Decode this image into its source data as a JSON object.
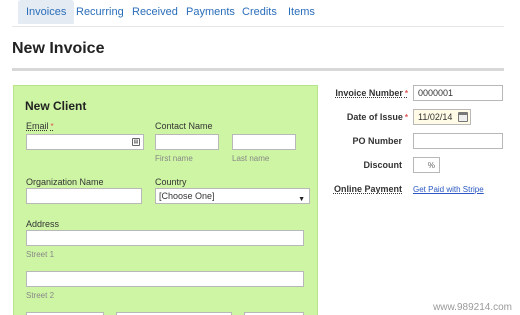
{
  "tabs": [
    {
      "label": "Invoices",
      "active": true
    },
    {
      "label": "Recurring",
      "active": false
    },
    {
      "label": "Received",
      "active": false
    },
    {
      "label": "Payments",
      "active": false
    },
    {
      "label": "Credits",
      "active": false
    },
    {
      "label": "Items",
      "active": false
    }
  ],
  "page_title": "New Invoice",
  "client": {
    "title": "New Client",
    "email_label": "Email",
    "email_value": "",
    "contact_label": "Contact Name",
    "first_name_hint": "First name",
    "last_name_hint": "Last name",
    "org_label": "Organization Name",
    "country_label": "Country",
    "country_selected": "[Choose One]",
    "address_label": "Address",
    "street1_hint": "Street 1",
    "street2_hint": "Street 2",
    "required_mark": "*"
  },
  "invoice": {
    "number_label": "Invoice Number",
    "number_value": "0000001",
    "date_label": "Date of Issue",
    "date_value": "11/02/14",
    "po_label": "PO Number",
    "po_value": "",
    "discount_label": "Discount",
    "discount_value": "",
    "discount_unit": "%",
    "online_payment_label": "Online Payment",
    "stripe_link": "Get Paid with Stripe",
    "required_mark": "*"
  },
  "watermark": "www.989214.com",
  "colors": {
    "panel_green": "#cdf5a4",
    "link_blue": "#2a6ebb",
    "active_tab": "#e4ebf2",
    "required_red": "#e05050"
  }
}
